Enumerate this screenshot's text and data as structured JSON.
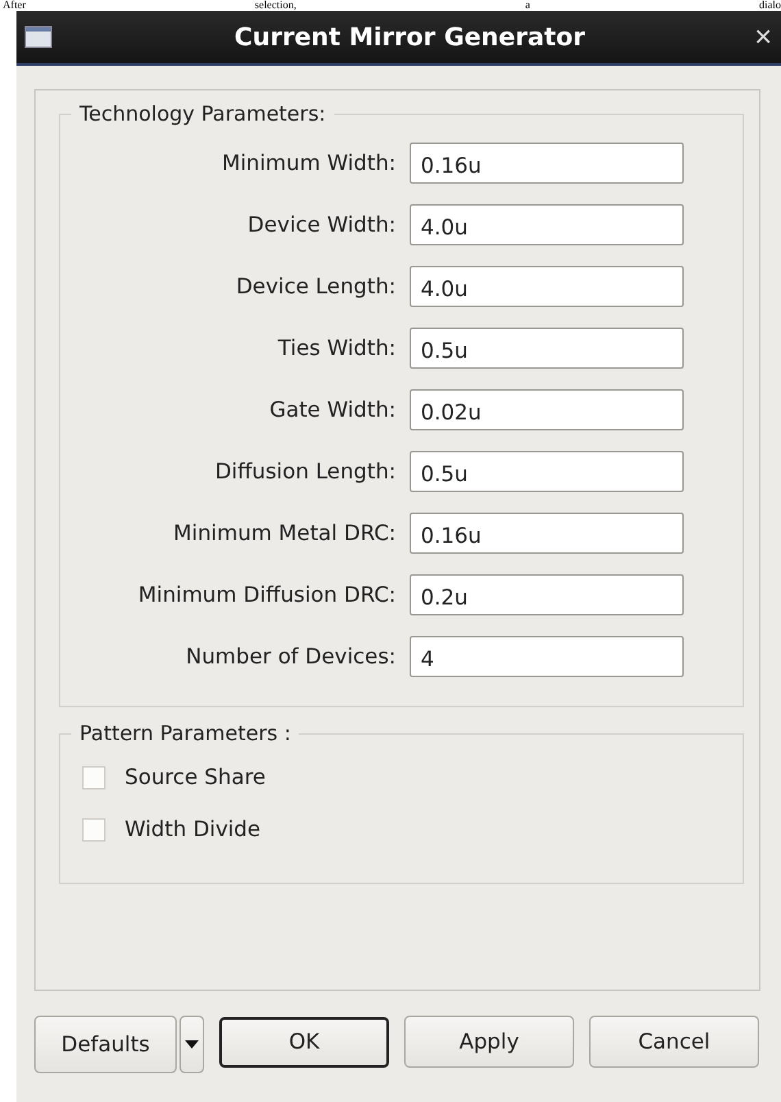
{
  "document_line": [
    "After",
    "selection,",
    "a",
    "dialo"
  ],
  "window": {
    "title": "Current Mirror Generator",
    "close": "×"
  },
  "technology_parameters": {
    "title": "Technology Parameters:",
    "fields": [
      {
        "label": "Minimum Width:",
        "value": "0.16u"
      },
      {
        "label": "Device Width:",
        "value": "4.0u"
      },
      {
        "label": "Device Length:",
        "value": "4.0u"
      },
      {
        "label": "Ties Width:",
        "value": "0.5u"
      },
      {
        "label": "Gate Width:",
        "value": "0.02u"
      },
      {
        "label": "Diffusion Length:",
        "value": "0.5u"
      },
      {
        "label": "Minimum Metal DRC:",
        "value": "0.16u"
      },
      {
        "label": "Minimum Diffusion DRC:",
        "value": "0.2u"
      },
      {
        "label": "Number of Devices:",
        "value": "4"
      }
    ]
  },
  "pattern_parameters": {
    "title": "Pattern Parameters :",
    "options": [
      {
        "label": "Source Share",
        "checked": false
      },
      {
        "label": "Width Divide",
        "checked": false
      }
    ]
  },
  "buttons": [
    {
      "label": "Defaults",
      "kind": "split"
    },
    {
      "label": "OK",
      "kind": "default"
    },
    {
      "label": "Apply",
      "kind": "normal"
    },
    {
      "label": "Cancel",
      "kind": "normal"
    }
  ]
}
